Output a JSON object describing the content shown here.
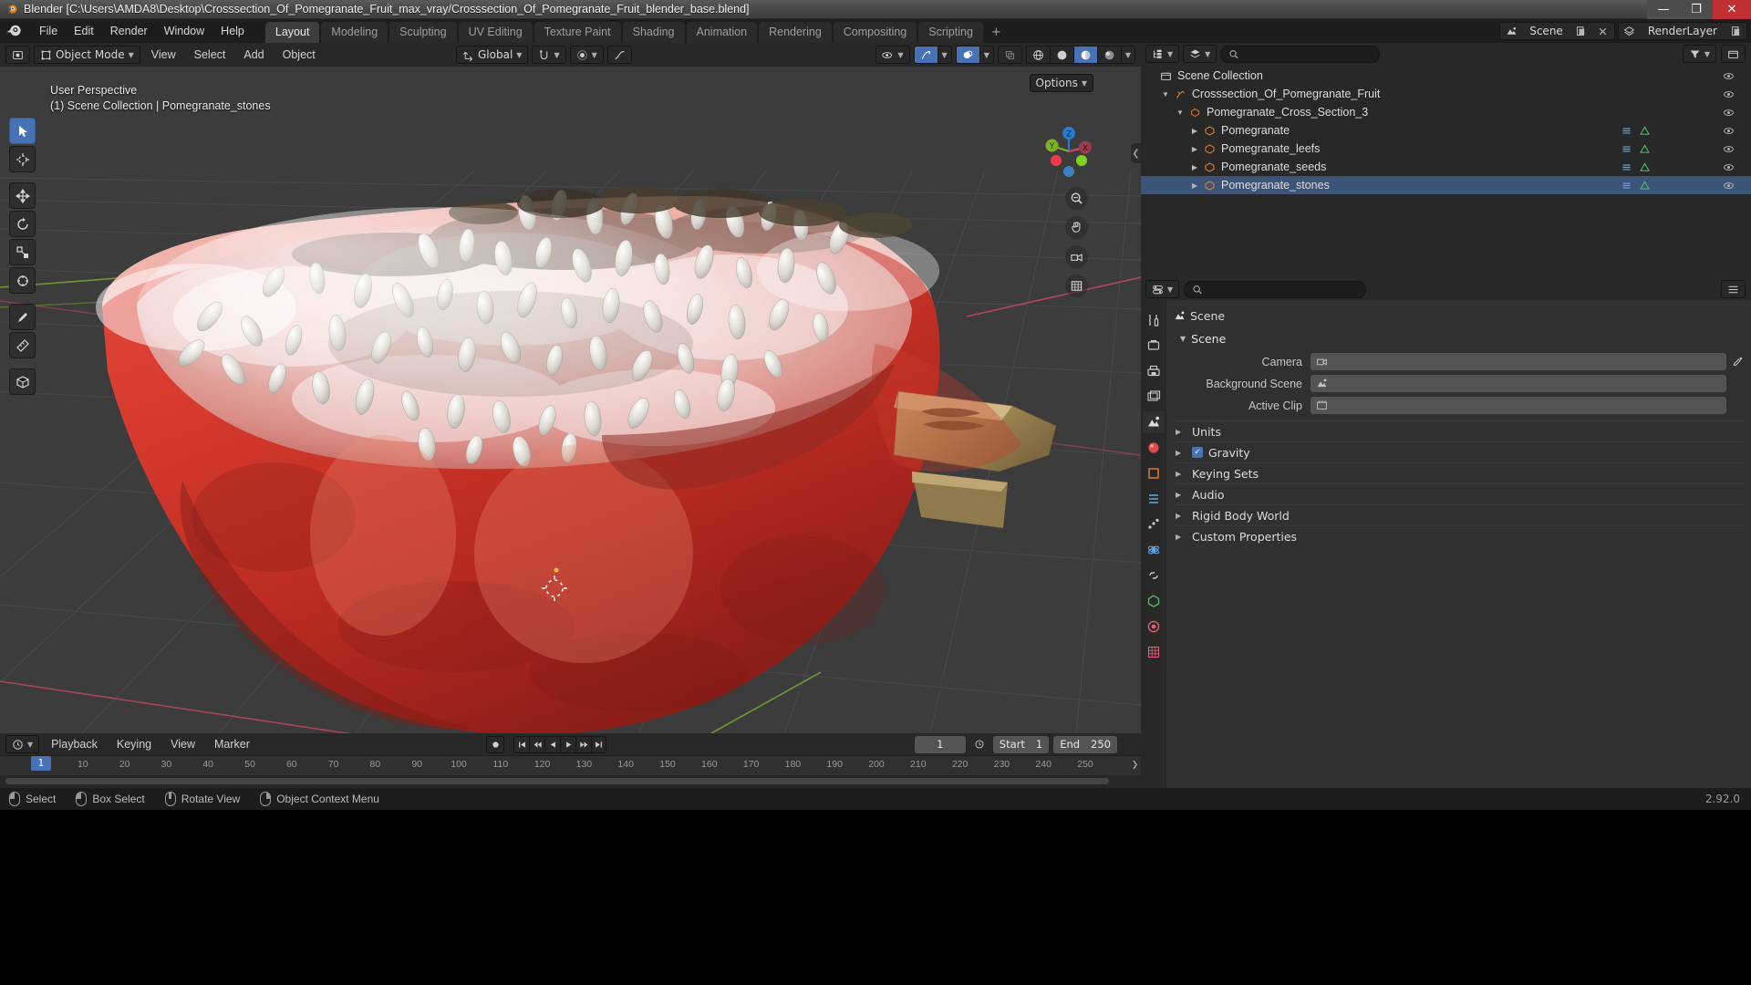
{
  "window": {
    "title": "Blender [C:\\Users\\AMDA8\\Desktop\\Crosssection_Of_Pomegranate_Fruit_max_vray/Crosssection_Of_Pomegranate_Fruit_blender_base.blend]",
    "minimize": "—",
    "maximize": "❐",
    "close": "✕"
  },
  "topbar": {
    "menus": [
      "File",
      "Edit",
      "Render",
      "Window",
      "Help"
    ],
    "workspaces": [
      {
        "label": "Layout",
        "active": true
      },
      {
        "label": "Modeling",
        "active": false
      },
      {
        "label": "Sculpting",
        "active": false
      },
      {
        "label": "UV Editing",
        "active": false
      },
      {
        "label": "Texture Paint",
        "active": false
      },
      {
        "label": "Shading",
        "active": false
      },
      {
        "label": "Animation",
        "active": false
      },
      {
        "label": "Rendering",
        "active": false
      },
      {
        "label": "Compositing",
        "active": false
      },
      {
        "label": "Scripting",
        "active": false
      }
    ],
    "add_workspace": "+",
    "scene_name": "Scene",
    "viewlayer_name": "RenderLayer"
  },
  "viewport": {
    "mode": "Object Mode",
    "menus": [
      "View",
      "Select",
      "Add",
      "Object"
    ],
    "transform_orientation": "Global",
    "options_label": "Options",
    "overlay_line1": "User Perspective",
    "overlay_line2": "(1) Scene Collection | Pomegranate_stones",
    "gizmo_axes": {
      "x": "X",
      "y": "Y",
      "z": "Z"
    },
    "tools": [
      "tweak-select-tool",
      "cursor-tool",
      "move-tool",
      "rotate-tool",
      "scale-tool",
      "transform-tool",
      "annotate-tool",
      "measure-tool",
      "add-cube-tool"
    ]
  },
  "outliner": {
    "display_mode": "View Layer",
    "search_placeholder": "",
    "rows": [
      {
        "label": "Scene Collection",
        "depth": 0,
        "icon": "collection-icon",
        "expander": "",
        "selected": false,
        "eye": true,
        "extra": []
      },
      {
        "label": "Crosssection_Of_Pomegranate_Fruit",
        "depth": 1,
        "icon": "armature-icon",
        "expander": "▼",
        "selected": false,
        "eye": true,
        "extra": []
      },
      {
        "label": "Pomegranate_Cross_Section_3",
        "depth": 2,
        "icon": "mesh-data-icon",
        "expander": "▼",
        "selected": false,
        "eye": true,
        "extra": []
      },
      {
        "label": "Pomegranate",
        "depth": 3,
        "icon": "mesh-object-icon",
        "expander": "▶",
        "selected": false,
        "eye": true,
        "extra": [
          "modifier-icon",
          "mesh-data-icon"
        ]
      },
      {
        "label": "Pomegranate_leefs",
        "depth": 3,
        "icon": "mesh-object-icon",
        "expander": "▶",
        "selected": false,
        "eye": true,
        "extra": [
          "modifier-icon",
          "mesh-data-icon"
        ]
      },
      {
        "label": "Pomegranate_seeds",
        "depth": 3,
        "icon": "mesh-object-icon",
        "expander": "▶",
        "selected": false,
        "eye": true,
        "extra": [
          "modifier-icon",
          "mesh-data-icon"
        ]
      },
      {
        "label": "Pomegranate_stones",
        "depth": 3,
        "icon": "mesh-object-icon",
        "expander": "▶",
        "selected": true,
        "eye": true,
        "extra": [
          "modifier-icon",
          "mesh-data-icon"
        ]
      }
    ]
  },
  "properties": {
    "search_placeholder": "",
    "breadcrumb": "Scene",
    "panel_title": "Scene",
    "fields": [
      {
        "label": "Camera",
        "value": "",
        "icon": "camera-icon",
        "eyedropper": true
      },
      {
        "label": "Background Scene",
        "value": "",
        "icon": "scene-icon",
        "eyedropper": false
      },
      {
        "label": "Active Clip",
        "value": "",
        "icon": "clip-icon",
        "eyedropper": false
      }
    ],
    "sections": [
      {
        "label": "Units",
        "expanded": false,
        "checkbox": null
      },
      {
        "label": "Gravity",
        "expanded": false,
        "checkbox": true
      },
      {
        "label": "Keying Sets",
        "expanded": false,
        "checkbox": null
      },
      {
        "label": "Audio",
        "expanded": false,
        "checkbox": null
      },
      {
        "label": "Rigid Body World",
        "expanded": false,
        "checkbox": null
      },
      {
        "label": "Custom Properties",
        "expanded": false,
        "checkbox": null
      }
    ],
    "tabs": [
      "tool-icon",
      "render-icon",
      "output-icon",
      "view-layer-icon",
      "scene-icon",
      "world-icon",
      "object-icon",
      "modifier-icon",
      "particles-icon",
      "physics-icon",
      "constraints-icon",
      "data-icon",
      "material-icon",
      "texture-icon"
    ],
    "active_tab_index": 4
  },
  "timeline": {
    "editor_type": "timeline-icon",
    "menus": [
      "Playback",
      "Keying",
      "View",
      "Marker"
    ],
    "current_frame": "1",
    "start_label": "Start",
    "start_value": "1",
    "end_label": "End",
    "end_value": "250",
    "ticks": [
      "10",
      "20",
      "30",
      "40",
      "50",
      "60",
      "70",
      "80",
      "90",
      "100",
      "110",
      "120",
      "130",
      "140",
      "150",
      "160",
      "170",
      "180",
      "190",
      "200",
      "210",
      "220",
      "230",
      "240",
      "250"
    ],
    "playhead_frame": "1",
    "transport": [
      "jump-start",
      "prev-keyframe",
      "play-reverse",
      "play",
      "next-keyframe",
      "jump-end"
    ]
  },
  "statusbar": {
    "items": [
      {
        "icon": "mouse-left-icon",
        "label": "Select"
      },
      {
        "icon": "mouse-left-drag-icon",
        "label": "Box Select"
      },
      {
        "icon": "mouse-middle-icon",
        "label": "Rotate View"
      },
      {
        "icon": "mouse-right-icon",
        "label": "Object Context Menu"
      }
    ],
    "version": "2.92.0"
  },
  "colors": {
    "accent_blue": "#4772b3",
    "header_dark": "#282828",
    "panel_bg": "#303030",
    "viewport_bg": "#3c3c3c",
    "axis_x": "#c7445a",
    "axis_y": "#7bb222",
    "axis_z": "#2a7ad0",
    "title_close": "#c03030",
    "selected_row": "#3b5478"
  }
}
